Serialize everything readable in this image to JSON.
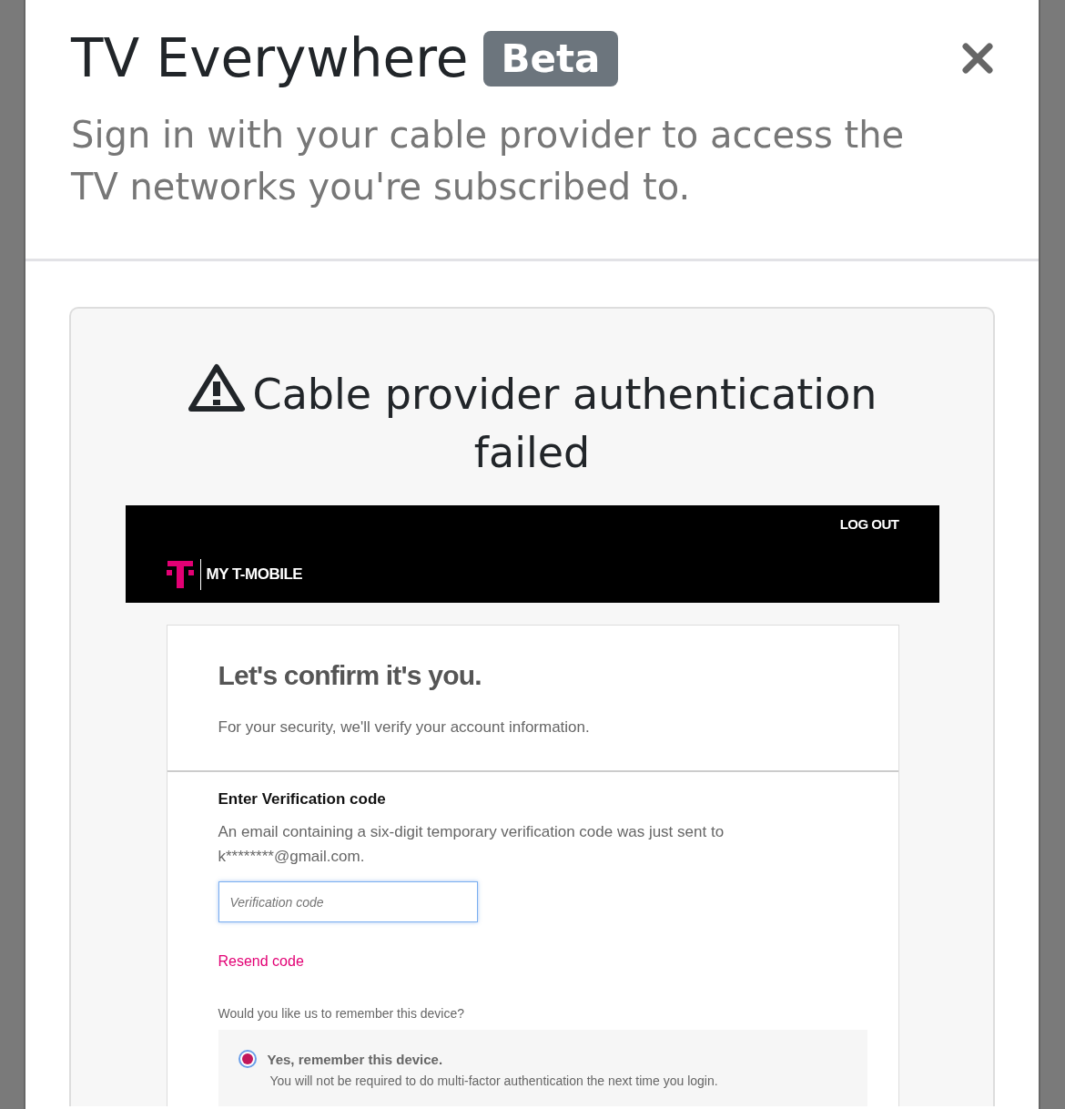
{
  "modal": {
    "title": "TV Everywhere",
    "badge": "Beta",
    "subtitle": "Sign in with your cable provider to access the TV networks you're subscribed to."
  },
  "error": {
    "heading": "Cable provider authentication failed"
  },
  "provider_page": {
    "header": {
      "logout": "LOG OUT",
      "brand": "MY T-MOBILE"
    },
    "intro": {
      "title": "Let's confirm it's you.",
      "text": "For your security, we'll verify your account information."
    },
    "verification": {
      "title": "Enter Verification code",
      "text": "An email containing a six-digit temporary verification code was just sent to k********@gmail.com.",
      "field": {
        "placeholder": "Verification code"
      },
      "resend": "Resend code"
    },
    "remember": {
      "question": "Would you like us to remember this device?",
      "options": [
        {
          "label": "Yes, remember this device.",
          "description": "You will not be required to do multi-factor authentication the next time you login.",
          "selected": true
        }
      ]
    }
  }
}
